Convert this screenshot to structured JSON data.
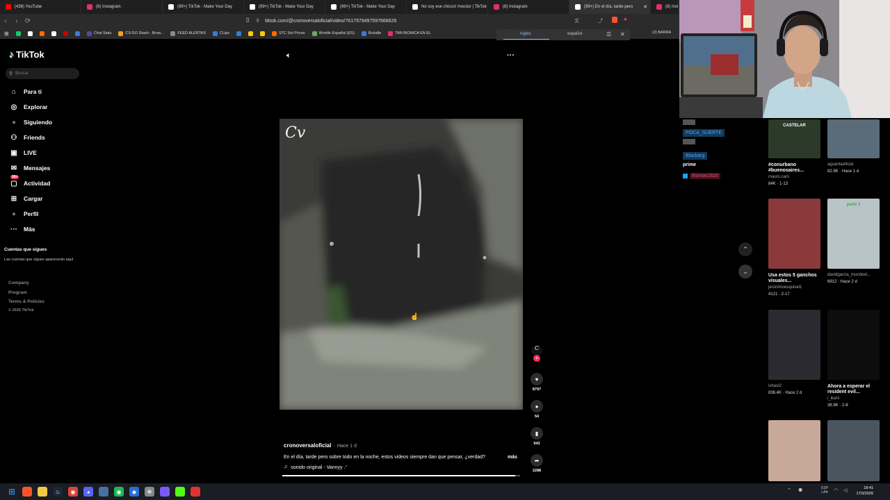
{
  "browser": {
    "tabs": [
      {
        "title": "(438) YouTube",
        "icon_color": "#ff0000",
        "active": false
      },
      {
        "title": "(8) Instagram",
        "icon_color": "#e1306c",
        "active": false
      },
      {
        "title": "(99+) TikTok - Make Your Day",
        "icon_color": "#ffffff",
        "active": false
      },
      {
        "title": "(99+) TikTok - Make Your Day",
        "icon_color": "#ffffff",
        "active": false
      },
      {
        "title": "(99+) TikTok - Make Your Day",
        "icon_color": "#ffffff",
        "active": false
      },
      {
        "title": "No soy ese chicos! #vector | TikTok",
        "icon_color": "#ffffff",
        "active": false
      },
      {
        "title": "(8) Instagram",
        "icon_color": "#e1306c",
        "active": false
      },
      {
        "title": "(99+) En el día, tarde pero",
        "icon_color": "#ffffff",
        "active": true
      },
      {
        "title": "(8) Inst",
        "icon_color": "#e1306c",
        "active": false
      }
    ],
    "url": "tiktok.com/@cronoversaloficial/video/7617979497597668626",
    "bookmarks": [
      {
        "label": "",
        "color": "#18c964"
      },
      {
        "label": "",
        "color": "#ffffff"
      },
      {
        "label": "",
        "color": "#ff6a00"
      },
      {
        "label": "",
        "color": "#ffffff"
      },
      {
        "label": "",
        "color": "#cc0000"
      },
      {
        "label": "",
        "color": "#3a7bd5"
      },
      {
        "label": "Chat Stats",
        "color": "#6441a5"
      },
      {
        "label": "CS:GO Stash - Brow...",
        "color": "#f0a020"
      },
      {
        "label": "FEED ALERTAS",
        "color": "#888888"
      },
      {
        "label": "CLips",
        "color": "#3a7bd5"
      },
      {
        "label": "",
        "color": "#3a7bd5"
      },
      {
        "label": "",
        "color": "#ffcc00"
      },
      {
        "label": "",
        "color": "#ffcc00"
      },
      {
        "label": "STC Set Prices",
        "color": "#ff6a00"
      },
      {
        "label": "Wordle Español (ES)",
        "color": "#6aaa64"
      },
      {
        "label": "Boludle",
        "color": "#3a7bd5"
      },
      {
        "label": "TAN BIONICA EN EL",
        "color": "#e1306c"
      }
    ],
    "translate": {
      "source": "inglés",
      "target": "español"
    },
    "right_bookmark": "(2) BARRA"
  },
  "tiktok": {
    "logo": "TikTok",
    "search_placeholder": "Buscar",
    "nav": [
      {
        "label": "Para ti",
        "icon": "home-icon"
      },
      {
        "label": "Explorar",
        "icon": "compass-icon"
      },
      {
        "label": "Siguiendo",
        "icon": "following-avatar-icon"
      },
      {
        "label": "Friends",
        "icon": "friends-icon"
      },
      {
        "label": "LIVE",
        "icon": "live-icon"
      },
      {
        "label": "Mensajes",
        "icon": "messages-icon"
      },
      {
        "label": "Actividad",
        "icon": "activity-icon",
        "badge": "99+"
      },
      {
        "label": "Cargar",
        "icon": "upload-icon"
      },
      {
        "label": "Perfil",
        "icon": "profile-avatar-icon"
      },
      {
        "label": "Más",
        "icon": "more-icon"
      }
    ],
    "following_title": "Cuentas que sigues",
    "following_empty": "Las cuentas que sigues aparecerán aquí",
    "footer": [
      "Company",
      "Program",
      "Terms & Policies"
    ],
    "copyright": "© 2026 TikTok"
  },
  "video": {
    "watermark": "Cv",
    "author": "cronoversaloficial",
    "posted": "Hace 1 d",
    "description": "En el día, tarde pero sobre todo en la noche, estos videos siempre dan que pensar, ¿verdad?",
    "more_label": "más",
    "sound": "sonido original - Vannyy .ᐟ",
    "likes": "8797",
    "comments": "54",
    "saves": "943",
    "shares": "2288",
    "progress": 0.98
  },
  "stream_chat": {
    "names": [
      "POCA_SUERTE",
      "Blackarg"
    ],
    "message": "prime",
    "user2": "thomas16z5"
  },
  "related": [
    {
      "overlay": "CASTELAR",
      "title": "#conurbano #buenosaires...",
      "author": "mauro.cam",
      "stats": "84K · 1-13"
    },
    {
      "title": "",
      "author": "aguantaoficial",
      "stats": "82.9K · Hace 1 d"
    },
    {
      "title": "Usa estos 5 ganchos visuales...",
      "author": "jeronimoesquivel1",
      "stats": "4121 · 2-17"
    },
    {
      "overlay": "parte 2",
      "title": "",
      "author": "davidgarcia_mundoel...",
      "stats": "6912 · Hace 2 d"
    },
    {
      "title": "",
      "author": "ishaul2",
      "stats": "836.4K · Hace 2 d"
    },
    {
      "title": "Ahora a esperar el resident evil...",
      "author": "i_ikarii",
      "stats": "38.9K · 2-8"
    },
    {
      "title": "",
      "author": "",
      "stats": ""
    },
    {
      "title": "",
      "author": "",
      "stats": ""
    }
  ],
  "taskbar": {
    "lang_line1": "ESP",
    "lang_line2": "LAA",
    "time": "18:41",
    "date": "17/3/2026"
  }
}
